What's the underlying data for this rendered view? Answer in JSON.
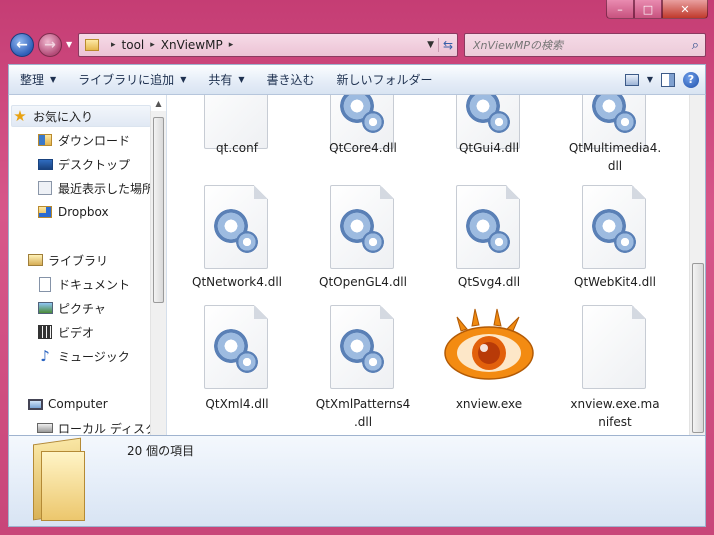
{
  "window": {
    "caption_buttons": {
      "minimize": "–",
      "maximize": "□",
      "close": "✕"
    }
  },
  "address": {
    "segments": [
      "tool",
      "XnViewMP"
    ],
    "separator": "▸"
  },
  "search": {
    "placeholder": "XnViewMPの検索"
  },
  "commands": {
    "organize": "整理",
    "add_to_library": "ライブラリに追加",
    "share": "共有",
    "burn": "書き込む",
    "new_folder": "新しいフォルダー"
  },
  "nav": {
    "favorites_header": "お気に入り",
    "favorites": [
      "ダウンロード",
      "デスクトップ",
      "最近表示した場所",
      "Dropbox"
    ],
    "libraries_header": "ライブラリ",
    "libraries": [
      "ドキュメント",
      "ピクチャ",
      "ビデオ",
      "ミュージック"
    ],
    "computer_header": "Computer",
    "computer": [
      "ローカル ディスク"
    ]
  },
  "files": [
    {
      "name": "qt.conf",
      "icon": "blank-file-icon"
    },
    {
      "name": "QtCore4.dll",
      "icon": "dll-gear-icon"
    },
    {
      "name": "QtGui4.dll",
      "icon": "dll-gear-icon"
    },
    {
      "name": "QtMultimedia4.\ndll",
      "icon": "dll-gear-icon"
    },
    {
      "name": "QtNetwork4.dll",
      "icon": "dll-gear-icon"
    },
    {
      "name": "QtOpenGL4.dll",
      "icon": "dll-gear-icon"
    },
    {
      "name": "QtSvg4.dll",
      "icon": "dll-gear-icon"
    },
    {
      "name": "QtWebKit4.dll",
      "icon": "dll-gear-icon"
    },
    {
      "name": "QtXml4.dll",
      "icon": "dll-gear-icon"
    },
    {
      "name": "QtXmlPatterns4\n.dll",
      "icon": "dll-gear-icon"
    },
    {
      "name": "xnview.exe",
      "icon": "xnview-eye-icon"
    },
    {
      "name": "xnview.exe.ma\nnifest",
      "icon": "blank-file-icon"
    }
  ],
  "status": {
    "item_count": "20 個の項目"
  },
  "colors": {
    "titlebar": "#c84679",
    "accent_blue": "#2f5fb8",
    "xnview_orange": "#f08a10"
  }
}
